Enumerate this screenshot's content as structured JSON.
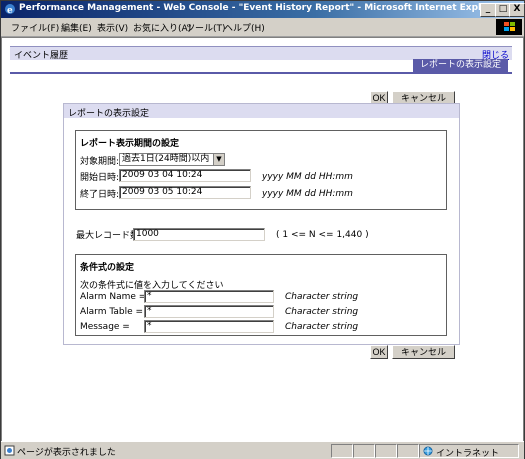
{
  "window": {
    "title": "Performance Management - Web Console - \"Event History Report\" - Microsoft Internet Explorer",
    "minimize": "_",
    "maximize": "□",
    "close": "X"
  },
  "menu": [
    "ファイル(F)",
    "編集(E)",
    "表示(V)",
    "お気に入り(A)",
    "ツール(T)",
    "ヘルプ(H)"
  ],
  "breadcrumb": "イベント履歴",
  "close_link": "閉じる",
  "tab": "レポートの表示設定",
  "ok_label": "OK",
  "cancel_label": "キャンセル",
  "panel": {
    "title": "レポートの表示設定",
    "period": {
      "heading": "レポート表示期間の設定",
      "target_label": "対象期間:",
      "target_value": "過去1日(24時間)以内",
      "start_label": "開始日時:",
      "start_value": "2009 03 04 10:24",
      "end_label": "終了日時:",
      "end_value": "2009 03 05 10:24",
      "format_hint": "yyyy MM dd HH:mm"
    },
    "max_records": {
      "label": "最大レコード数:",
      "value": "1000",
      "hint": "( 1 <= N <= 1,440 )"
    },
    "conditions": {
      "heading": "条件式の設定",
      "instruction": "次の条件式に値を入力してください",
      "rows": [
        {
          "label": "Alarm Name =",
          "value": "*",
          "type": "Character string"
        },
        {
          "label": "Alarm Table =",
          "value": "*",
          "type": "Character string"
        },
        {
          "label": "Message =",
          "value": "*",
          "type": "Character string"
        }
      ]
    }
  },
  "status": {
    "text": "ページが表示されました",
    "zone": "イントラネット"
  }
}
